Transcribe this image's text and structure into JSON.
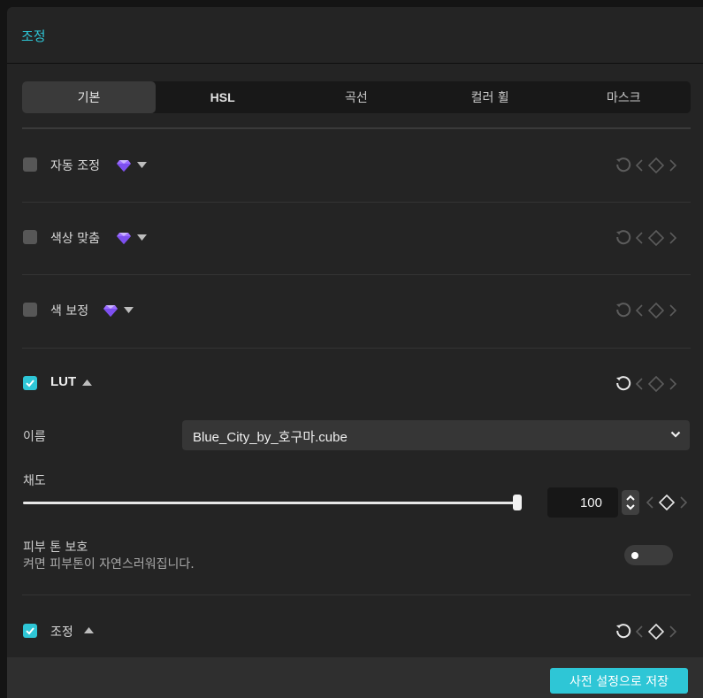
{
  "panel": {
    "title": "조정"
  },
  "tabs": [
    {
      "label": "기본",
      "active": true
    },
    {
      "label": "HSL",
      "active": false
    },
    {
      "label": "곡선",
      "active": false
    },
    {
      "label": "컬러 휠",
      "active": false
    },
    {
      "label": "마스크",
      "active": false
    }
  ],
  "sections": {
    "auto_adjust": {
      "label": "자동 조정",
      "checked": false,
      "premium": true,
      "expanded": false
    },
    "color_match": {
      "label": "색상 맞춤",
      "checked": false,
      "premium": true,
      "expanded": false
    },
    "color_correction": {
      "label": "색 보정",
      "checked": false,
      "premium": true,
      "expanded": false
    },
    "lut": {
      "label": "LUT",
      "checked": true,
      "expanded": true
    },
    "adjust": {
      "label": "조정",
      "checked": true,
      "expanded": true
    }
  },
  "lut": {
    "name_label": "이름",
    "name_value": "Blue_City_by_호구마.cube",
    "saturation_label": "채도",
    "saturation_value": "100",
    "saturation_level": 1.0,
    "skin_label": "피부 톤 보호",
    "skin_desc": "켜면 피부톤이 자연스러워집니다.",
    "skin_enabled": false
  },
  "footer": {
    "save_label": "사전 설정으로 저장"
  },
  "colors": {
    "accent": "#2ec6d6",
    "premium_gem": "#9b6cff",
    "panel_bg": "#242424"
  },
  "icons": [
    "gem-icon",
    "caret-down-icon",
    "caret-up-icon",
    "reset-icon",
    "keyframe-prev-icon",
    "keyframe-diamond-icon",
    "keyframe-next-icon",
    "chevron-down-icon",
    "stepper-icon",
    "check-icon"
  ]
}
